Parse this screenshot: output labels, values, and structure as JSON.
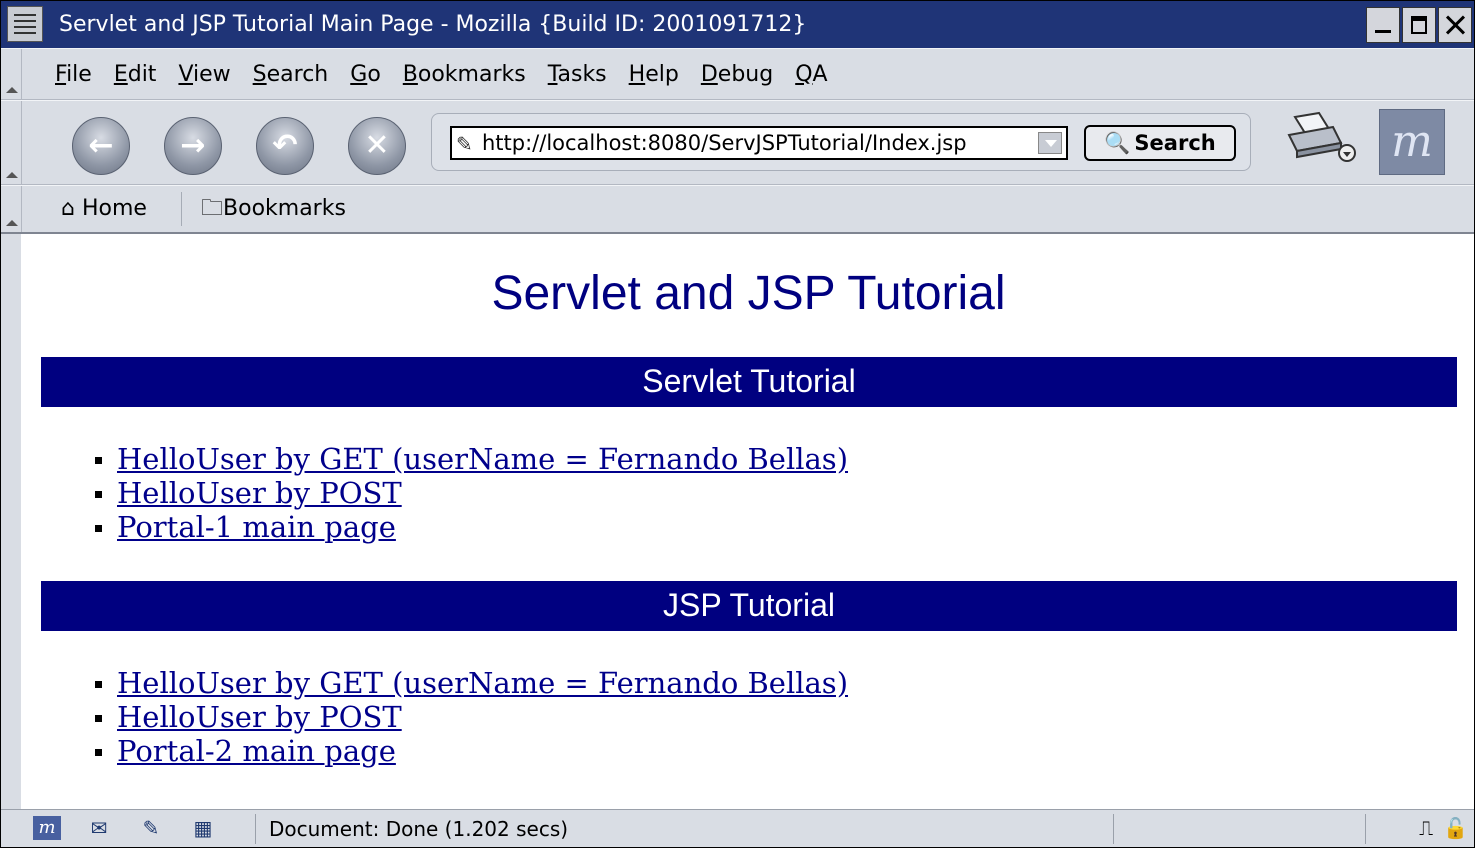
{
  "window": {
    "title": "Servlet and JSP Tutorial Main Page - Mozilla {Build ID: 2001091712}"
  },
  "menubar": {
    "items": [
      "File",
      "Edit",
      "View",
      "Search",
      "Go",
      "Bookmarks",
      "Tasks",
      "Help",
      "Debug",
      "QA"
    ]
  },
  "navbar": {
    "url": "http://localhost:8080/ServJSPTutorial/Index.jsp",
    "search_label": "Search"
  },
  "personalbar": {
    "home_label": "Home",
    "bookmarks_label": "Bookmarks"
  },
  "page": {
    "title": "Servlet and JSP Tutorial",
    "sections": [
      {
        "heading": "Servlet Tutorial",
        "links": [
          "HelloUser by GET (userName = Fernando Bellas)",
          "HelloUser by POST",
          "Portal-1 main page"
        ]
      },
      {
        "heading": "JSP Tutorial",
        "links": [
          "HelloUser by GET (userName = Fernando Bellas)",
          "HelloUser by POST",
          "Portal-2 main page"
        ]
      }
    ]
  },
  "statusbar": {
    "text": "Document: Done (1.202 secs)"
  },
  "colors": {
    "titlebar": "#1f3477",
    "section_bar": "#000080",
    "page_title": "#000080",
    "link": "#00008b"
  }
}
